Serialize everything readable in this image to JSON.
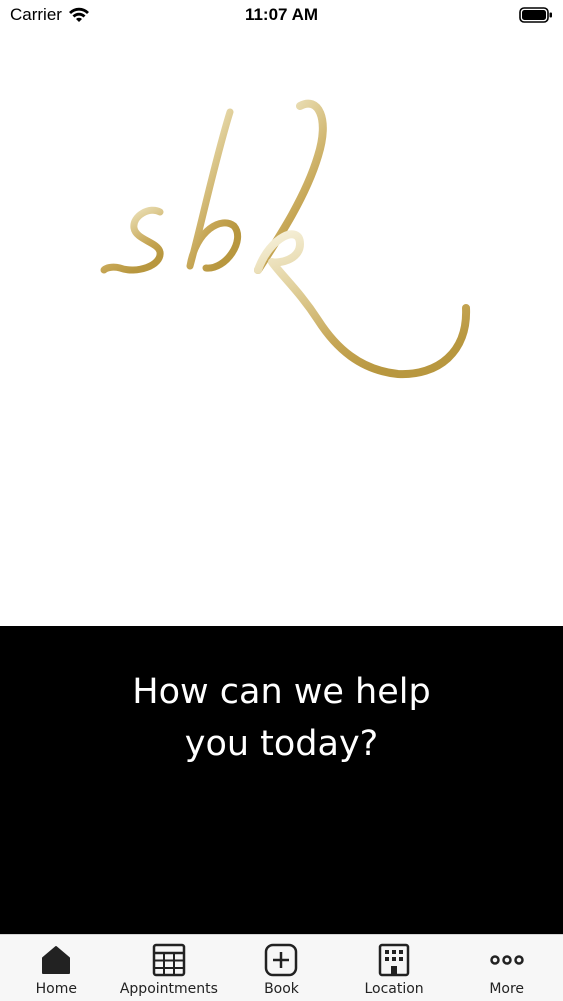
{
  "status_bar": {
    "carrier": "Carrier",
    "time": "11:07 AM"
  },
  "logo": {
    "text": "sbk",
    "gradient_light": "#f6f0d6",
    "gradient_dark": "#b8973f"
  },
  "hero": {
    "message": "How can we help you today?"
  },
  "tabs": [
    {
      "label": "Home",
      "icon": "home-icon",
      "active": true
    },
    {
      "label": "Appointments",
      "icon": "calendar-grid-icon",
      "active": false
    },
    {
      "label": "Book",
      "icon": "plus-square-icon",
      "active": false
    },
    {
      "label": "Location",
      "icon": "building-icon",
      "active": false
    },
    {
      "label": "More",
      "icon": "more-dots-icon",
      "active": false
    }
  ],
  "colors": {
    "panel_background": "#000000",
    "tab_bar_background": "#f7f7f7"
  }
}
